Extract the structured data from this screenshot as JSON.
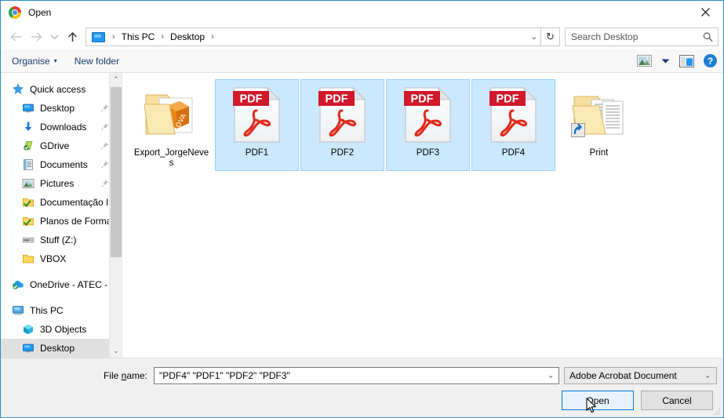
{
  "window": {
    "title": "Open",
    "app_icon": "chrome-icon",
    "close_label": "✕",
    "accent_color": "#2c8bc9"
  },
  "nav": {
    "back_label": "←",
    "forward_label": "→",
    "recent_label": "⌄",
    "up_label": "↑",
    "breadcrumb": [
      "This PC",
      "Desktop"
    ],
    "breadcrumb_separator": "›",
    "breadcrumb_caret": "⌄",
    "refresh_label": "↻"
  },
  "search": {
    "placeholder": "Search Desktop",
    "value": "",
    "icon": "search-icon"
  },
  "toolbar": {
    "organise_label": "Organise",
    "organise_caret": "▾",
    "new_folder_label": "New folder",
    "view_icon": "view-options-icon",
    "view_caret": "▾",
    "preview_pane_icon": "preview-pane-icon",
    "help_label": "?"
  },
  "sidebar": {
    "scroll_up": "⌃",
    "scroll_down": "⌄",
    "groups": [
      {
        "header": {
          "label": "Quick access",
          "icon": "star-pin-icon",
          "indent": false,
          "pinned": false,
          "selected": false
        },
        "items": [
          {
            "label": "Desktop",
            "icon": "monitor-icon",
            "indent": true,
            "pinned": true,
            "selected": false
          },
          {
            "label": "Downloads",
            "icon": "download-arrow-icon",
            "indent": true,
            "pinned": true,
            "selected": false
          },
          {
            "label": "GDrive",
            "icon": "gdrive-icon",
            "indent": true,
            "pinned": true,
            "selected": false
          },
          {
            "label": "Documents",
            "icon": "documents-icon",
            "indent": true,
            "pinned": true,
            "selected": false
          },
          {
            "label": "Pictures",
            "icon": "pictures-icon",
            "indent": true,
            "pinned": true,
            "selected": false
          },
          {
            "label": "Documentação I",
            "icon": "synced-folder-icon",
            "indent": true,
            "pinned": false,
            "selected": false
          },
          {
            "label": "Planos de Forma",
            "icon": "synced-folder-icon",
            "indent": true,
            "pinned": false,
            "selected": false
          },
          {
            "label": "Stuff (Z:)",
            "icon": "drive-icon",
            "indent": true,
            "pinned": false,
            "selected": false
          },
          {
            "label": "VBOX",
            "icon": "folder-icon",
            "indent": true,
            "pinned": false,
            "selected": false
          }
        ]
      },
      {
        "header": {
          "label": "OneDrive - ATEC -",
          "icon": "onedrive-icon",
          "indent": false,
          "pinned": false,
          "selected": false
        },
        "items": []
      },
      {
        "header": {
          "label": "This PC",
          "icon": "thispc-icon",
          "indent": false,
          "pinned": false,
          "selected": false
        },
        "items": [
          {
            "label": "3D Objects",
            "icon": "3dobjects-icon",
            "indent": true,
            "pinned": false,
            "selected": false
          },
          {
            "label": "Desktop",
            "icon": "monitor-icon",
            "indent": true,
            "pinned": false,
            "selected": true
          }
        ]
      }
    ]
  },
  "files": [
    {
      "name": "Export_JorgeNeves",
      "icon": "ova-folder-icon",
      "selected": false,
      "shortcut": false
    },
    {
      "name": "PDF1",
      "icon": "pdf-file-icon",
      "selected": true,
      "shortcut": false
    },
    {
      "name": "PDF2",
      "icon": "pdf-file-icon",
      "selected": true,
      "shortcut": false
    },
    {
      "name": "PDF3",
      "icon": "pdf-file-icon",
      "selected": true,
      "shortcut": false
    },
    {
      "name": "PDF4",
      "icon": "pdf-file-icon",
      "selected": true,
      "shortcut": false
    },
    {
      "name": "Print",
      "icon": "documents-folder-icon",
      "selected": false,
      "shortcut": true
    }
  ],
  "pdf_badge_text": "PDF",
  "ova_badge_text": "OVA",
  "footer": {
    "filename_label_pre": "File ",
    "filename_label_accel": "n",
    "filename_label_post": "ame:",
    "filename_value": "\"PDF4\" \"PDF1\" \"PDF2\" \"PDF3\"",
    "filename_caret": "⌄",
    "filetype_value": "Adobe Acrobat Document",
    "filetype_caret": "⌄",
    "open_label": "Open",
    "cancel_label": "Cancel"
  }
}
